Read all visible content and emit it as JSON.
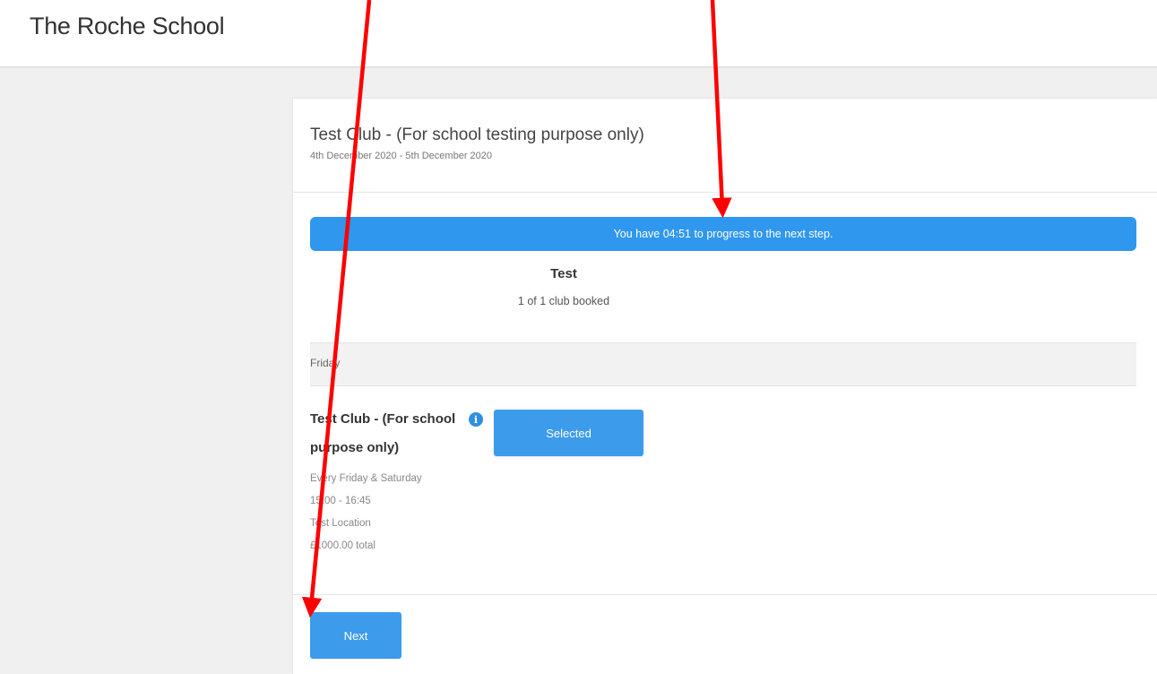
{
  "header": {
    "school_name": "The Roche School"
  },
  "club": {
    "title": "Test Club - (For school testing purpose only)",
    "dates": "4th December 2020 - 5th December 2020"
  },
  "timer": {
    "message": "You have 04:51 to progress to the next step."
  },
  "summary": {
    "name": "Test",
    "booked": "1 of 1 club booked"
  },
  "day": {
    "label": "Friday"
  },
  "session": {
    "title": "Test Club - (For school purpose only)",
    "schedule": "Every Friday & Saturday",
    "time": "15:00 - 16:45",
    "location": "Test Location",
    "price": "£1000.00 total",
    "info_icon": "info-icon",
    "button_label": "Selected"
  },
  "footer": {
    "next_label": "Next"
  },
  "colors": {
    "accent": "#2f97ee",
    "annotation_arrow": "#ff0000"
  }
}
